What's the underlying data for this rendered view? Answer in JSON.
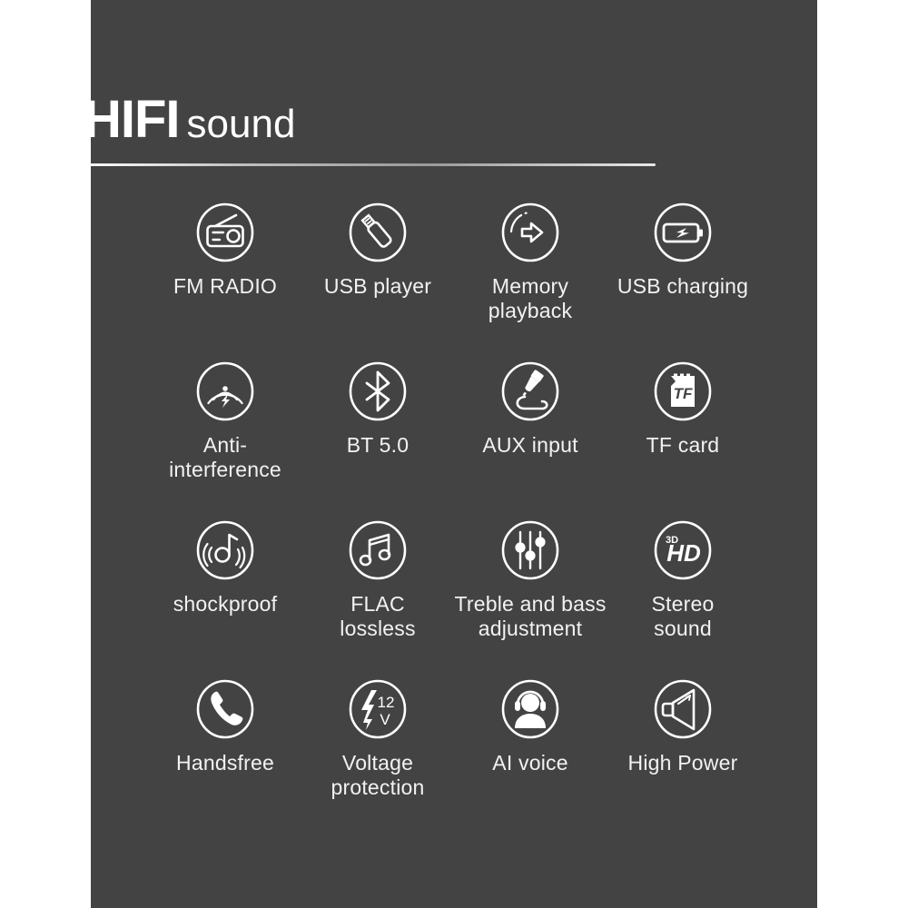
{
  "header": {
    "title_bold": "HIFI",
    "title_light": "sound"
  },
  "colors": {
    "panel_background": "#434343",
    "page_background": "#ffffff",
    "icon_stroke": "#ffffff",
    "caption_text": "#f2f2f2"
  },
  "features": [
    [
      {
        "icon": "fm-radio-icon",
        "label": "FM RADIO"
      },
      {
        "icon": "usb-stick-icon",
        "label": "USB player"
      },
      {
        "icon": "memory-playback-icon",
        "label": "Memory\nplayback"
      },
      {
        "icon": "battery-charging-icon",
        "label": "USB charging"
      }
    ],
    [
      {
        "icon": "anti-interference-icon",
        "label": "Anti-interference"
      },
      {
        "icon": "bluetooth-icon",
        "label": "BT 5.0"
      },
      {
        "icon": "aux-jack-icon",
        "label": "AUX input"
      },
      {
        "icon": "tf-card-icon",
        "label": "TF card",
        "icon_text": "TF"
      }
    ],
    [
      {
        "icon": "shockproof-note-icon",
        "label": "shockproof"
      },
      {
        "icon": "music-note-icon",
        "label": "FLAC\nlossless"
      },
      {
        "icon": "equalizer-sliders-icon",
        "label": "Treble and bass\nadjustment"
      },
      {
        "icon": "hd-3d-icon",
        "label": "Stereo\nsound",
        "icon_text": "HD",
        "icon_text_small": "3D"
      }
    ],
    [
      {
        "icon": "phone-handset-icon",
        "label": "Handsfree"
      },
      {
        "icon": "voltage-bolt-icon",
        "label": "Voltage\nprotection",
        "icon_text": "12",
        "icon_text_small": "V"
      },
      {
        "icon": "headset-person-icon",
        "label": "AI voice"
      },
      {
        "icon": "speaker-horn-icon",
        "label": "High Power"
      }
    ]
  ]
}
